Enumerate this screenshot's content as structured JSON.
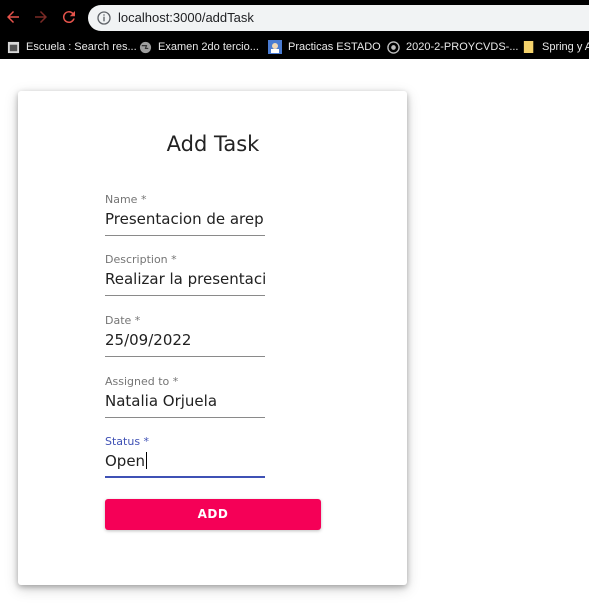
{
  "browser": {
    "url": "localhost:3000/addTask",
    "bookmarks": [
      {
        "label": "Escuela : Search res...",
        "icon": "bookmark-page-icon"
      },
      {
        "label": "Examen 2do tercio...",
        "icon": "globe-icon"
      },
      {
        "label": "Practicas ESTADO",
        "icon": "image-icon"
      },
      {
        "label": "2020-2-PROYCVDS-...",
        "icon": "github-icon"
      },
      {
        "label": "Spring y A",
        "icon": "folder-icon"
      }
    ]
  },
  "form": {
    "title": "Add Task",
    "fields": [
      {
        "label": "Name *",
        "value": "Presentacion de arep"
      },
      {
        "label": "Description *",
        "value": "Realizar la presentación c"
      },
      {
        "label": "Date *",
        "value": "25/09/2022"
      },
      {
        "label": "Assigned to *",
        "value": "Natalia Orjuela"
      },
      {
        "label": "Status *",
        "value": "Open"
      }
    ],
    "submit_label": "ADD"
  },
  "colors": {
    "accent": "#f50057",
    "focus": "#3f51b5"
  }
}
